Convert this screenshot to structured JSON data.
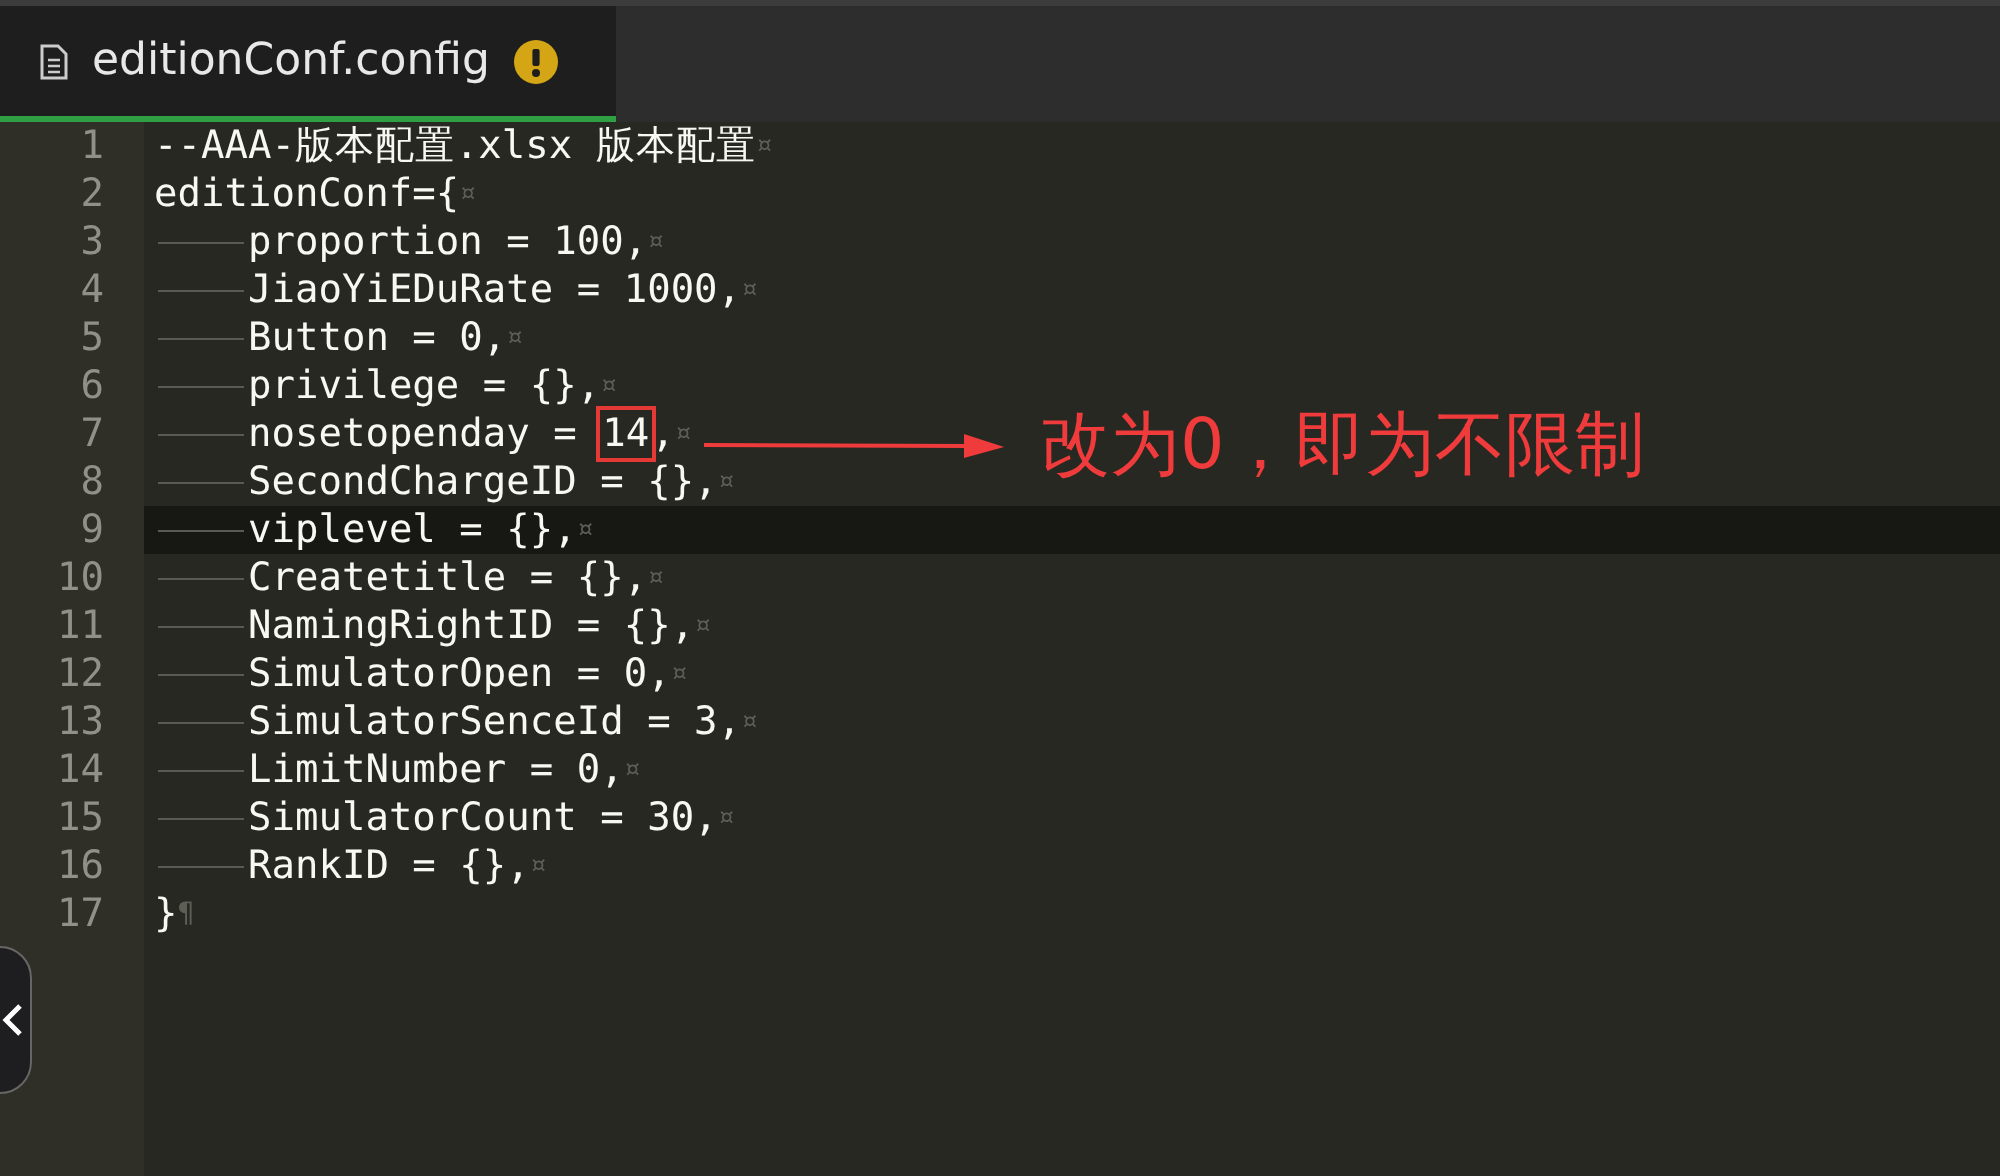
{
  "tab": {
    "title": "editionConf.config",
    "selected": true,
    "warning": true
  },
  "lines": [
    {
      "number": "1",
      "indent": false,
      "code": "--AAA-版本配置.xlsx 版本配置",
      "eol": "¤",
      "current": false
    },
    {
      "number": "2",
      "indent": false,
      "code": "editionConf={",
      "eol": "¤",
      "current": false
    },
    {
      "number": "3",
      "indent": true,
      "code": "proportion = 100,",
      "eol": "¤",
      "current": false
    },
    {
      "number": "4",
      "indent": true,
      "code": "JiaoYiEDuRate = 1000,",
      "eol": "¤",
      "current": false
    },
    {
      "number": "5",
      "indent": true,
      "code": "Button = 0,",
      "eol": "¤",
      "current": false
    },
    {
      "number": "6",
      "indent": true,
      "code": "privilege = {},",
      "eol": "¤",
      "current": false
    },
    {
      "number": "7",
      "indent": true,
      "code": "nosetopenday = ",
      "boxed": "14",
      "code_after": ",",
      "eol": "¤",
      "current": false
    },
    {
      "number": "8",
      "indent": true,
      "code": "SecondChargeID = {},",
      "eol": "¤",
      "current": false
    },
    {
      "number": "9",
      "indent": true,
      "code": "viplevel = {},",
      "eol": "¤",
      "current": true
    },
    {
      "number": "10",
      "indent": true,
      "code": "Createtitle = {},",
      "eol": "¤",
      "current": false
    },
    {
      "number": "11",
      "indent": true,
      "code": "NamingRightID = {},",
      "eol": "¤",
      "current": false
    },
    {
      "number": "12",
      "indent": true,
      "code": "SimulatorOpen = 0,",
      "eol": "¤",
      "current": false
    },
    {
      "number": "13",
      "indent": true,
      "code": "SimulatorSenceId = 3,",
      "eol": "¤",
      "current": false
    },
    {
      "number": "14",
      "indent": true,
      "code": "LimitNumber = 0,",
      "eol": "¤",
      "current": false
    },
    {
      "number": "15",
      "indent": true,
      "code": "SimulatorCount = 30,",
      "eol": "¤",
      "current": false
    },
    {
      "number": "16",
      "indent": true,
      "code": "RankID = {},",
      "eol": "¤",
      "current": false
    },
    {
      "number": "17",
      "indent": false,
      "code": "}",
      "eol": "¶",
      "current": false
    }
  ],
  "annotation": {
    "text": "改为0，即为不限制"
  }
}
